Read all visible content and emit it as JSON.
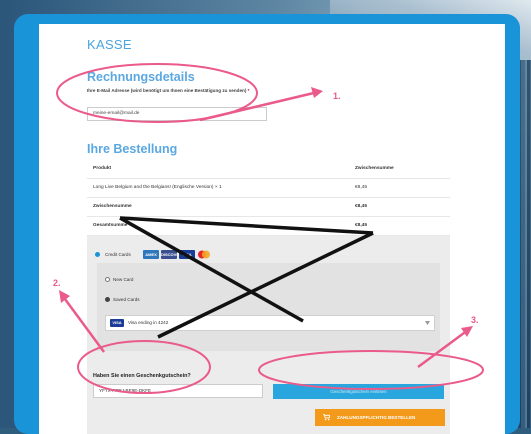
{
  "page": {
    "title": "KASSE",
    "billing_heading": "Rechnungsdetails",
    "email_label": "Ihre E-Mail Adresse (wird benötigt um Ihnen eine Bestätigung zu senden)",
    "email_required": "*",
    "email_value": "meine-email@mail.de",
    "order_heading": "Ihre Bestellung"
  },
  "order_table": {
    "columns": [
      "Produkt",
      "Zwischensumme"
    ],
    "rows": [
      {
        "product": "Long Live Belgium and the Belgians! (Englische Version)  × 1",
        "amount": "€8,45"
      },
      {
        "product": "Zwischensumme",
        "amount": "€8,45"
      },
      {
        "product": "Gesamtsumme",
        "amount": "€8,45"
      }
    ]
  },
  "payment": {
    "method_label": "Credit Cards",
    "card_logos": [
      "AMEX",
      "DISCOVER",
      "VISA",
      "MC"
    ],
    "new_card": "New Card",
    "saved_cards": "Saved Cards",
    "saved_card_value": "Visa ending in 4242",
    "saved_card_brand": "VISA",
    "voucher_label": "Haben Sie einen Geschenkgutschein?",
    "voucher_value": "YFTX-PPRJ-BE9E-DKFE",
    "redeem_button": "Geschenkgutschein einlösen",
    "order_button": "ZAHLUNGSPFLICHTIG BESTELLEN"
  },
  "annotations": [
    "1.",
    "2.",
    "3."
  ],
  "colors": {
    "brand_blue": "#1a94d8",
    "heading_blue": "#5aa8e2",
    "order_orange": "#f39a1b",
    "annotation_pink": "#ea5a8a",
    "cross_black": "#111111"
  },
  "icons": [
    "cart-icon",
    "chevron-down-icon",
    "arrow-icon"
  ]
}
